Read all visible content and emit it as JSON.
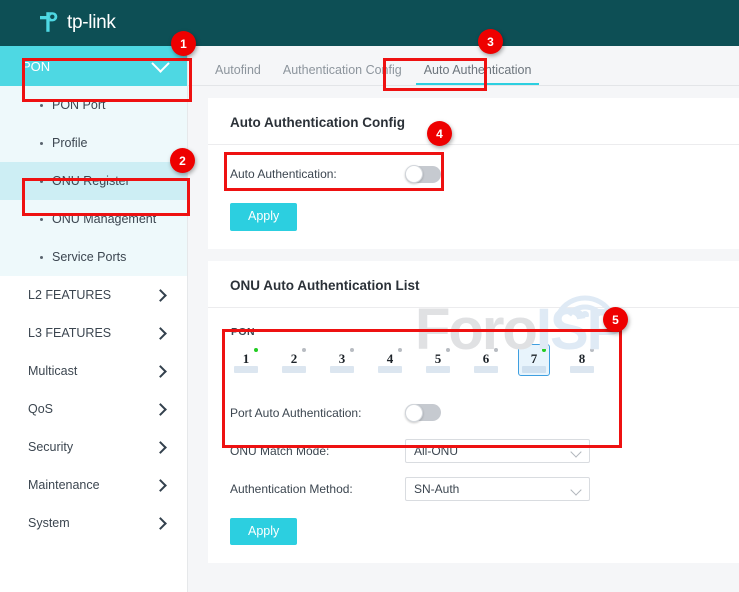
{
  "brand": {
    "name": "tp-link",
    "logo_icon": "tplink-logo-icon"
  },
  "sidebar": {
    "active_group": {
      "label": "PON",
      "icon": "chevron-down-icon"
    },
    "sub_items": [
      {
        "label": "PON Port",
        "selected": false
      },
      {
        "label": "Profile",
        "selected": false
      },
      {
        "label": "ONU Register",
        "selected": true
      },
      {
        "label": "ONU Management",
        "selected": false
      },
      {
        "label": "Service Ports",
        "selected": false
      }
    ],
    "items": [
      {
        "label": "L2 FEATURES",
        "icon": "chevron-right-icon"
      },
      {
        "label": "L3 FEATURES",
        "icon": "chevron-right-icon"
      },
      {
        "label": "Multicast",
        "icon": "chevron-right-icon"
      },
      {
        "label": "QoS",
        "icon": "chevron-right-icon"
      },
      {
        "label": "Security",
        "icon": "chevron-right-icon"
      },
      {
        "label": "Maintenance",
        "icon": "chevron-right-icon"
      },
      {
        "label": "System",
        "icon": "chevron-right-icon"
      }
    ]
  },
  "tabs": [
    {
      "label": "Autofind",
      "active": false
    },
    {
      "label": "Authentication Config",
      "active": false
    },
    {
      "label": "Auto Authentication",
      "active": true
    }
  ],
  "config_card": {
    "title": "Auto Authentication Config",
    "toggle_label": "Auto Authentication:",
    "toggle_state": "off",
    "apply_label": "Apply"
  },
  "list_card": {
    "title": "ONU Auto Authentication List",
    "ports_group_label": "PON",
    "ports": [
      {
        "num": "1",
        "led": "green",
        "selected": false
      },
      {
        "num": "2",
        "led": "gray",
        "selected": false
      },
      {
        "num": "3",
        "led": "gray",
        "selected": false
      },
      {
        "num": "4",
        "led": "gray",
        "selected": false
      },
      {
        "num": "5",
        "led": "gray",
        "selected": false
      },
      {
        "num": "6",
        "led": "gray",
        "selected": false
      },
      {
        "num": "7",
        "led": "green",
        "selected": true
      },
      {
        "num": "8",
        "led": "gray",
        "selected": false
      }
    ],
    "port_toggle_label": "Port Auto Authentication:",
    "port_toggle_state": "off",
    "match_mode_label": "ONU Match Mode:",
    "match_mode_value": "All-ONU",
    "auth_method_label": "Authentication Method:",
    "auth_method_value": "SN-Auth",
    "apply_label": "Apply"
  },
  "watermark": {
    "part1": "Foro",
    "part2": "ISP"
  },
  "annotations": {
    "badges": [
      {
        "n": "1"
      },
      {
        "n": "2"
      },
      {
        "n": "3"
      },
      {
        "n": "4"
      },
      {
        "n": "5"
      }
    ]
  },
  "colors": {
    "topbar": "#0d4f55",
    "accent_cyan": "#2ccfe0",
    "menu_active": "#4ed8e3",
    "submenu_bg": "#eef9fb",
    "submenu_selected": "#cdeef4",
    "annotation_red": "#ee1111",
    "led_on": "#22cc22",
    "port_selected_border": "#3f9fe0"
  }
}
